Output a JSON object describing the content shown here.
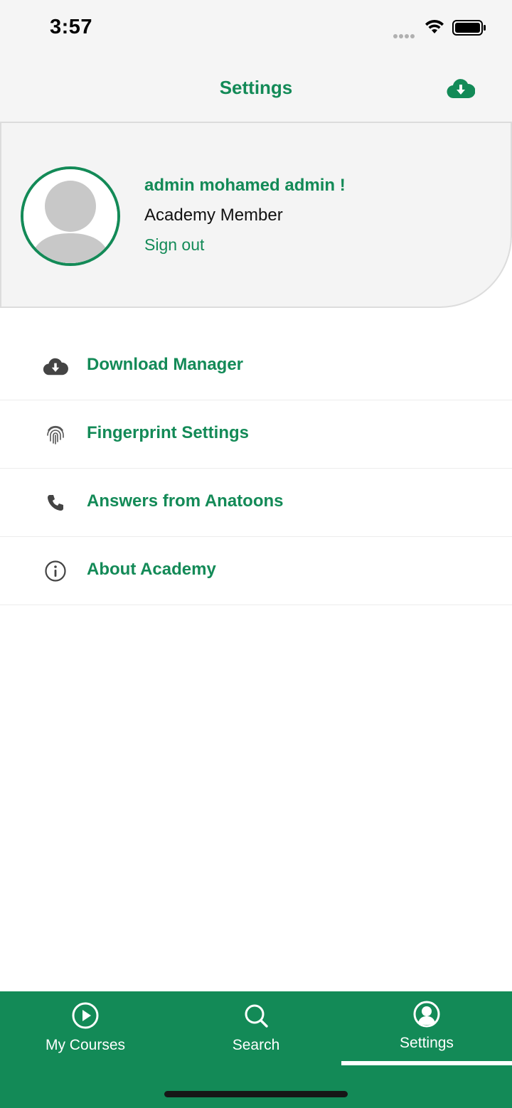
{
  "status_bar": {
    "time": "3:57"
  },
  "header": {
    "title": "Settings",
    "action_icon": "cloud-download-icon"
  },
  "profile": {
    "name": "admin mohamed admin !",
    "role": "Academy Member",
    "signout_label": "Sign out"
  },
  "menu": {
    "items": [
      {
        "label": "Download Manager",
        "icon": "cloud-download-icon"
      },
      {
        "label": "Fingerprint Settings",
        "icon": "fingerprint-icon"
      },
      {
        "label": "Answers from Anatoons",
        "icon": "phone-icon"
      },
      {
        "label": "About Academy",
        "icon": "info-icon"
      }
    ]
  },
  "tabs": {
    "items": [
      {
        "label": "My Courses",
        "icon": "play-circle-icon"
      },
      {
        "label": "Search",
        "icon": "search-icon"
      },
      {
        "label": "Settings",
        "icon": "user-circle-icon"
      }
    ],
    "active": "Settings"
  },
  "colors": {
    "accent": "#138a57",
    "header_bg": "#f5f5f5",
    "card_bg": "#f4f4f4",
    "icon_gray": "#444444"
  }
}
